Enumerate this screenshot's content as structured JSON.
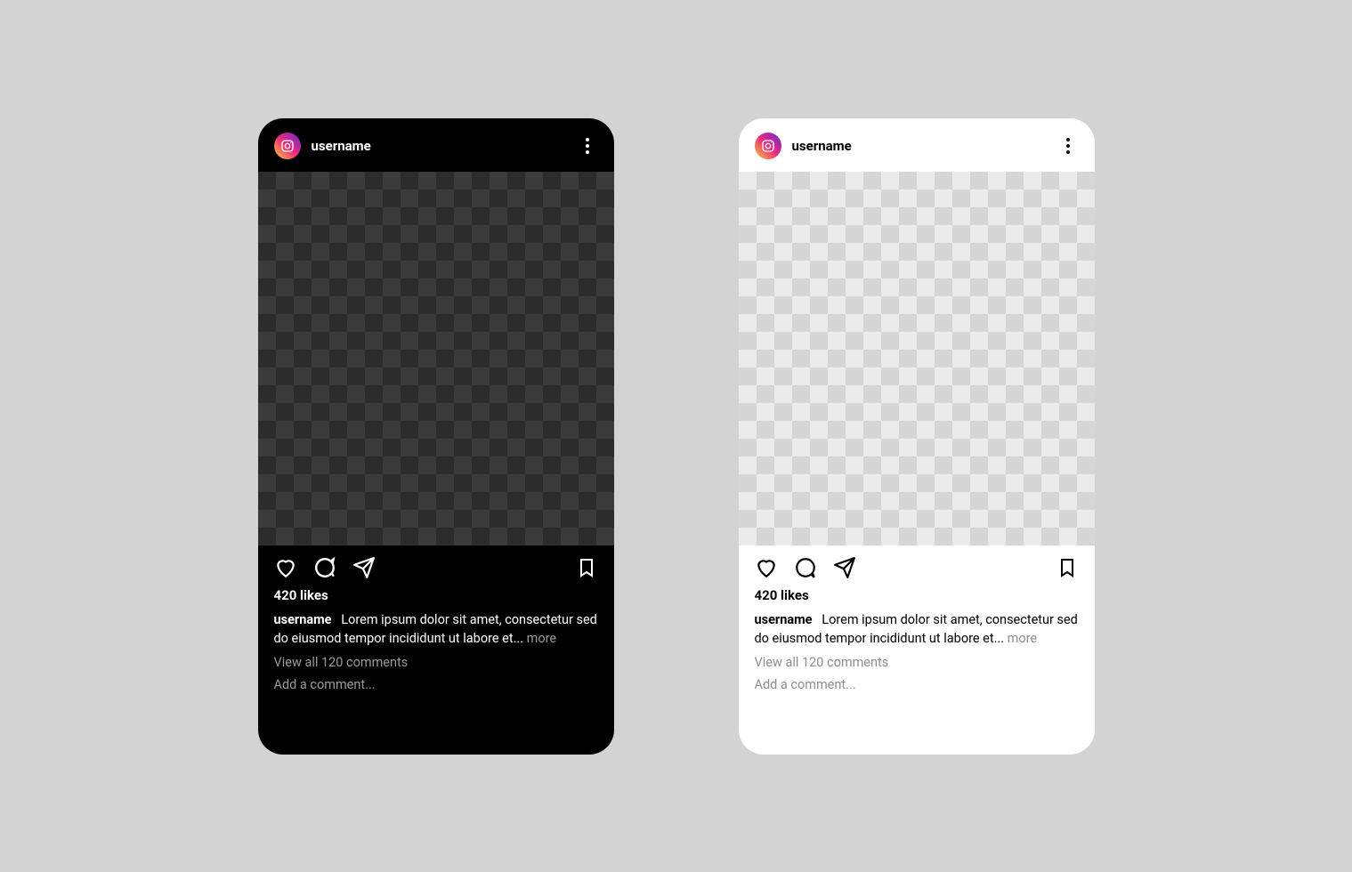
{
  "post": {
    "username": "username",
    "likes_label": "420 likes",
    "caption_user": "username",
    "caption_text": "Lorem ipsum dolor sit amet, consectetur sed do eiusmod tempor incididunt ut labore et...",
    "more_label": "more",
    "view_comments": "View all 120 comments",
    "add_comment": "Add a comment..."
  }
}
